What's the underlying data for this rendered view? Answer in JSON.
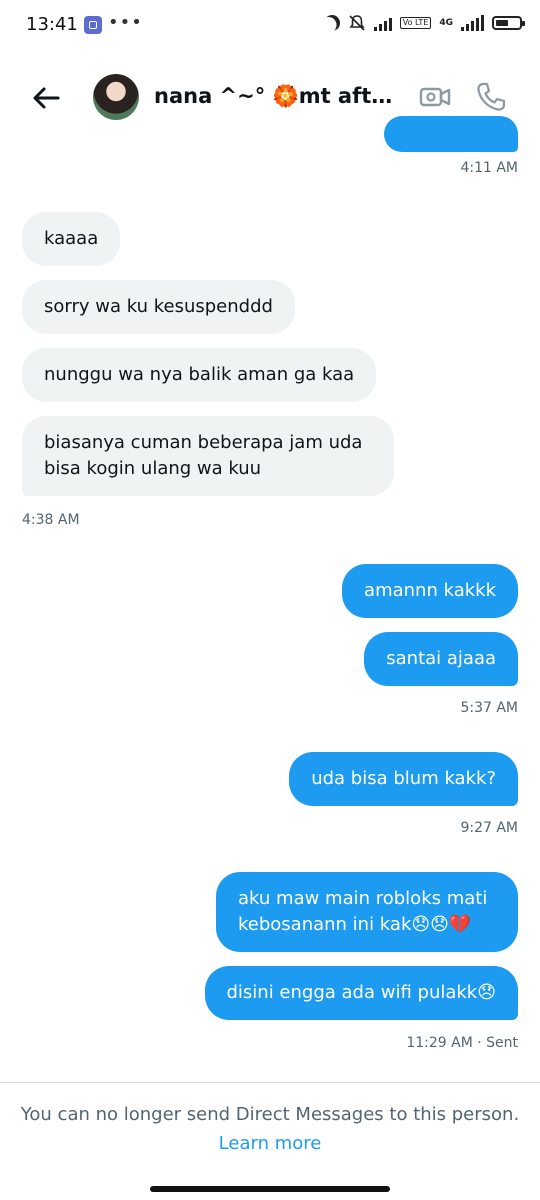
{
  "status_bar": {
    "time": "13:41",
    "dots": "•••",
    "network_tag": "Vo LTE",
    "network_type": "4G"
  },
  "header": {
    "title": "nana ^~° 🏵️mt after ...",
    "back_icon": "arrow-left-icon",
    "video_icon": "video-call-icon",
    "phone_icon": "phone-icon"
  },
  "messages": [
    {
      "text": "kaaaa"
    },
    {
      "text": "sorry wa ku kesuspenddd"
    },
    {
      "text": "nunggu wa nya balik aman ga kaa"
    },
    {
      "text": "biasanya cuman beberapa jam uda bisa kogin ulang wa kuu"
    },
    {
      "text": "amannn kakkk"
    },
    {
      "text": "santai ajaaa"
    },
    {
      "text": "uda bisa blum kakk?"
    },
    {
      "text": "aku maw main robloks mati kebosanann ini kak😞😞💔"
    },
    {
      "text": "disini engga ada wifi pulakk😞"
    }
  ],
  "timestamps": {
    "t0": "4:11 AM",
    "t1": "4:38 AM",
    "t2": "5:37 AM",
    "t3": "9:27 AM",
    "t4": "11:29 AM · Sent"
  },
  "footer": {
    "notice": "You can no longer send Direct Messages to this person.",
    "learn_more": "Learn more"
  },
  "colors": {
    "accent": "#1d9bf0",
    "incoming_bubble": "#eff3f4",
    "muted_text": "#536471"
  }
}
